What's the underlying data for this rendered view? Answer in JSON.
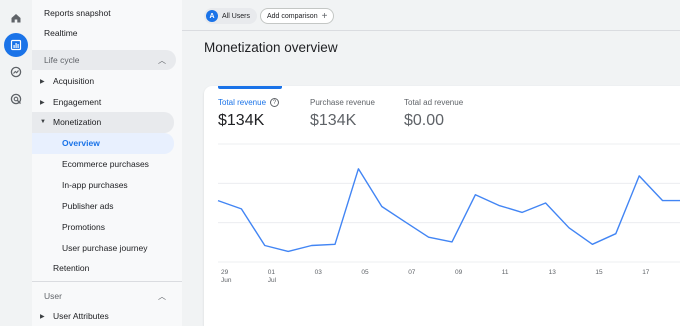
{
  "rail": {
    "icons": [
      "home-icon",
      "reports-icon",
      "explore-icon",
      "advertising-icon"
    ]
  },
  "nav": {
    "reports_snapshot": "Reports snapshot",
    "realtime": "Realtime",
    "life_cycle": "Life cycle",
    "acquisition": "Acquisition",
    "engagement": "Engagement",
    "monetization": "Monetization",
    "overview": "Overview",
    "ecommerce": "Ecommerce purchases",
    "inapp": "In-app purchases",
    "publisher_ads": "Publisher ads",
    "promotions": "Promotions",
    "user_purchase_journey": "User purchase journey",
    "retention": "Retention",
    "user": "User",
    "user_attributes": "User Attributes"
  },
  "header": {
    "segment_avatar": "A",
    "segment_label": "All Users",
    "add_comparison": "Add comparison",
    "page_title": "Monetization overview"
  },
  "metrics": [
    {
      "label": "Total revenue",
      "value": "$134K"
    },
    {
      "label": "Purchase revenue",
      "value": "$134K"
    },
    {
      "label": "Total ad revenue",
      "value": "$0.00"
    }
  ],
  "chart_data": {
    "type": "line",
    "x_ticks": [
      {
        "day": "29",
        "month": "Jun"
      },
      {
        "day": "01",
        "month": "Jul"
      },
      {
        "day": "03",
        "month": ""
      },
      {
        "day": "05",
        "month": ""
      },
      {
        "day": "07",
        "month": ""
      },
      {
        "day": "09",
        "month": ""
      },
      {
        "day": "11",
        "month": ""
      },
      {
        "day": "13",
        "month": ""
      },
      {
        "day": "15",
        "month": ""
      },
      {
        "day": "17",
        "month": ""
      }
    ],
    "x": [
      "Jun 29",
      "Jun 30",
      "Jul 1",
      "Jul 2",
      "Jul 3",
      "Jul 4",
      "Jul 5",
      "Jul 6",
      "Jul 7",
      "Jul 8",
      "Jul 9",
      "Jul 10",
      "Jul 11",
      "Jul 12",
      "Jul 13",
      "Jul 14",
      "Jul 15",
      "Jul 16",
      "Jul 17",
      "Jul 18",
      "Jul 19"
    ],
    "series": [
      {
        "values": [
          0.52,
          0.45,
          0.14,
          0.09,
          0.14,
          0.15,
          0.79,
          0.47,
          0.34,
          0.21,
          0.17,
          0.57,
          0.48,
          0.42,
          0.5,
          0.29,
          0.15,
          0.24,
          0.73,
          0.52,
          0.52
        ]
      }
    ],
    "gridlines": 3,
    "color": "#4285f4"
  }
}
